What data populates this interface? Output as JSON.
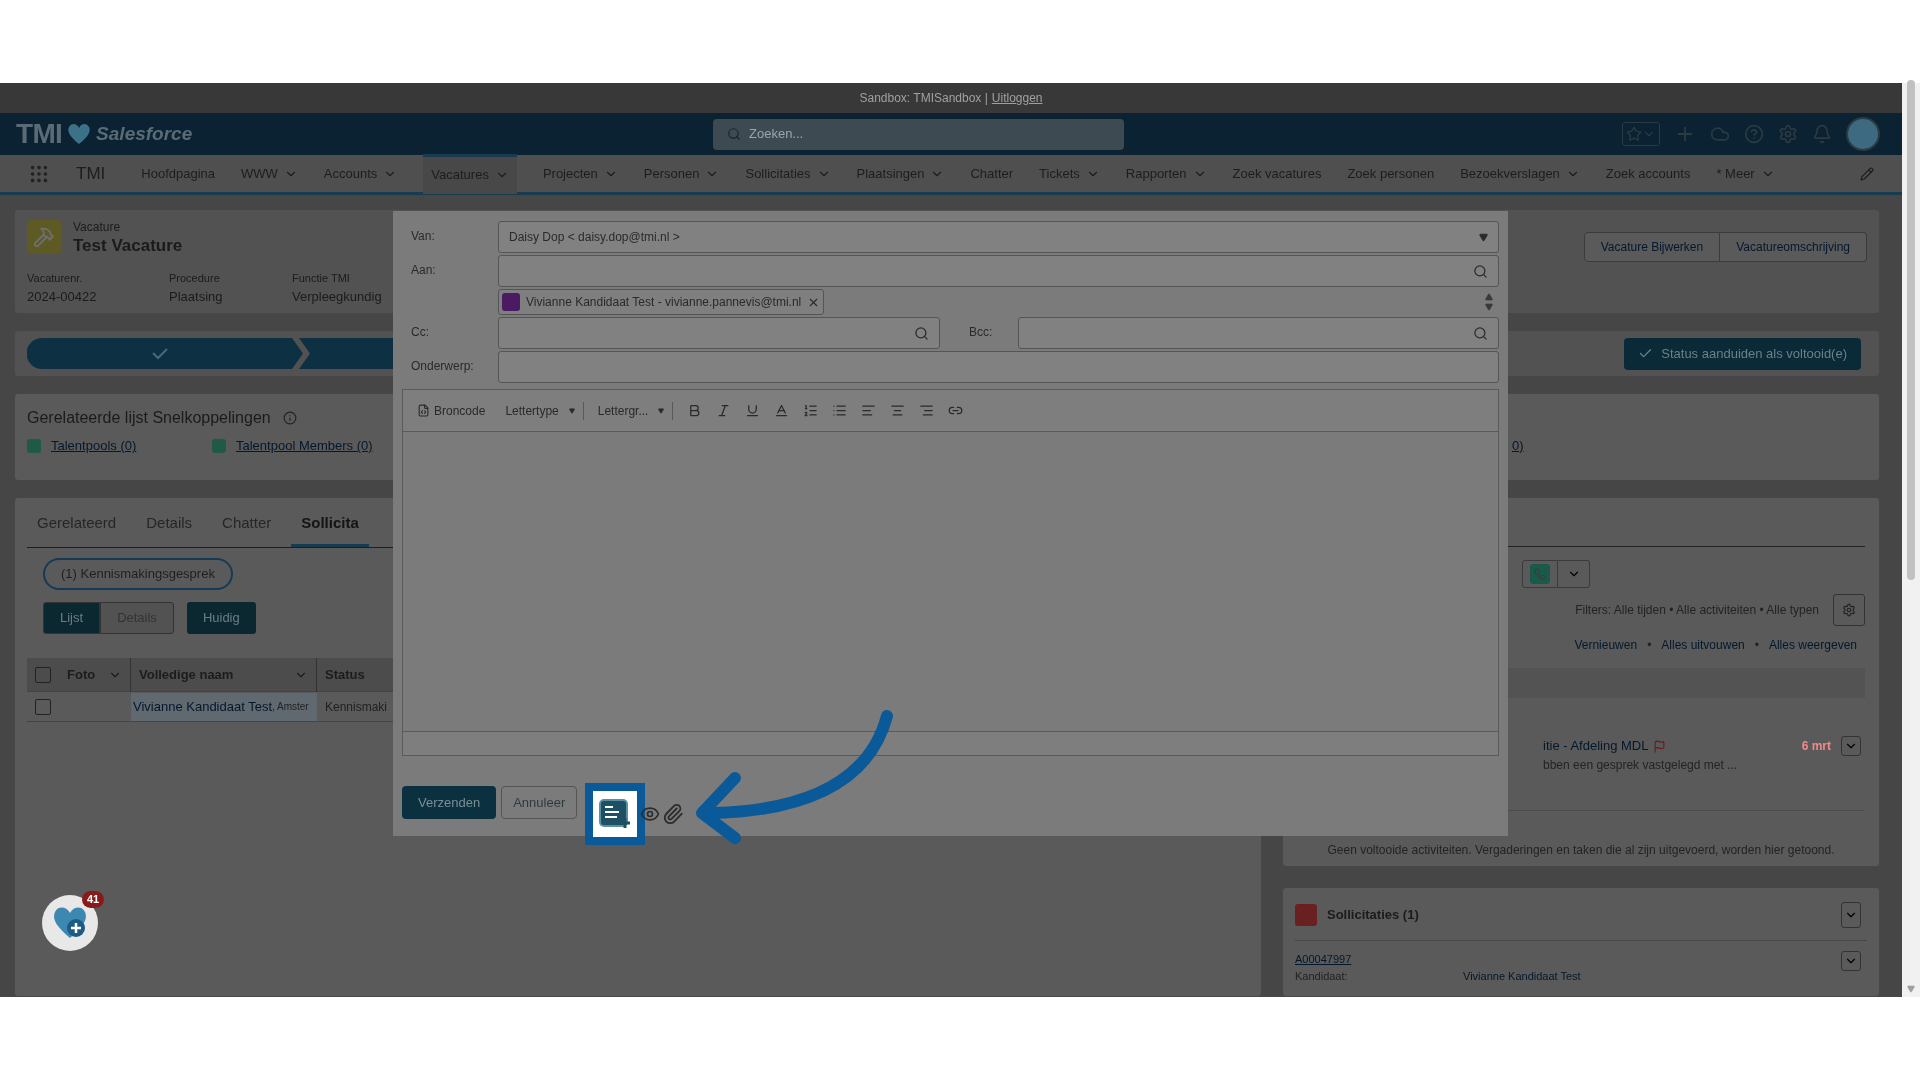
{
  "sandbox_bar": {
    "text": "Sandbox: TMISandbox |",
    "link": "Uitloggen"
  },
  "header": {
    "logo": "TMI",
    "brand": "Salesforce",
    "search": {
      "placeholder": "Zoeken..."
    }
  },
  "nav": {
    "app_name": "TMI",
    "items": [
      {
        "label": "Hoofdpagina",
        "dropdown": false,
        "selected": false
      },
      {
        "label": "WWW",
        "dropdown": true,
        "selected": false
      },
      {
        "label": "Accounts",
        "dropdown": true,
        "selected": false
      },
      {
        "label": "Vacatures",
        "dropdown": true,
        "selected": true
      },
      {
        "label": "Projecten",
        "dropdown": true,
        "selected": false
      },
      {
        "label": "Personen",
        "dropdown": true,
        "selected": false
      },
      {
        "label": "Sollicitaties",
        "dropdown": true,
        "selected": false
      },
      {
        "label": "Plaatsingen",
        "dropdown": true,
        "selected": false
      },
      {
        "label": "Chatter",
        "dropdown": false,
        "selected": false
      },
      {
        "label": "Tickets",
        "dropdown": true,
        "selected": false
      },
      {
        "label": "Rapporten",
        "dropdown": true,
        "selected": false
      },
      {
        "label": "Zoek vacatures",
        "dropdown": false,
        "selected": false
      },
      {
        "label": "Zoek personen",
        "dropdown": false,
        "selected": false
      },
      {
        "label": "Bezoekverslagen",
        "dropdown": true,
        "selected": false
      },
      {
        "label": "Zoek accounts",
        "dropdown": false,
        "selected": false
      }
    ],
    "more": "* Meer"
  },
  "record": {
    "type": "Vacature",
    "title": "Test Vacature",
    "fields": [
      {
        "label": "Vacaturenr.",
        "value": "2024-00422"
      },
      {
        "label": "Procedure",
        "value": "Plaatsing"
      },
      {
        "label": "Functie TMI",
        "value": "Verpleegkundig"
      }
    ],
    "actions": [
      "Vacature Bijwerken",
      "Vacatureomschrijving"
    ]
  },
  "path": {
    "complete_button": "Status aanduiden als voltooid(e)"
  },
  "quick_links": {
    "title": "Gerelateerde lijst Snelkoppelingen",
    "links": [
      "Talentpools (0)",
      "Talentpool Members (0)",
      "0)"
    ]
  },
  "tabs": [
    {
      "label": "Gerelateerd",
      "selected": false
    },
    {
      "label": "Details",
      "selected": false
    },
    {
      "label": "Chatter",
      "selected": false
    },
    {
      "label": "Sollicita",
      "selected": true
    }
  ],
  "list_view": {
    "filter_chip": "(1) Kennismakingsgesprek",
    "view_toggle": [
      {
        "label": "Lijst",
        "selected": true
      },
      {
        "label": "Details",
        "selected": false
      }
    ],
    "current_button": "Huidig",
    "all_selected": false,
    "columns": [
      {
        "label": "Foto",
        "kind": "sortable"
      },
      {
        "label": "Volledige naam",
        "kind": "sortable"
      },
      {
        "label": "Status",
        "kind": "plain"
      }
    ],
    "rows": [
      {
        "checked": false,
        "name": "Vivianne Kandidaat Test",
        "location": ", Amster",
        "status": "Kennismaki"
      }
    ]
  },
  "activity": {
    "filters": "Filters: Alle tijden • Alle activiteiten • Alle typen",
    "actions": [
      "Vernieuwen",
      "Alles uitvouwen",
      "Alles weergeven"
    ],
    "separator": "•",
    "item": {
      "title": "itie - Afdeling MDL",
      "date": "6 mrt",
      "description": "bben een gesprek vastgelegd met ..."
    },
    "empty_text": "Geen voltooide activiteiten. Vergaderingen en taken die al zijn uitgevoerd, worden hier getoond."
  },
  "applications_card": {
    "title": "Sollicitaties (1)",
    "record": "A00047997",
    "label": "Kandidaat:",
    "candidate": "Vivianne Kandidaat Test"
  },
  "email_dialog": {
    "from": {
      "label": "Van:",
      "value": "Daisy Dop < daisy.dop@tmi.nl >"
    },
    "to": {
      "label": "Aan:",
      "recipients": [
        "Vivianne Kandidaat Test - vivianne.pannevis@tmi.nl"
      ]
    },
    "cc": {
      "label": "Cc:"
    },
    "bcc": {
      "label": "Bcc:"
    },
    "subject": {
      "label": "Onderwerp:"
    },
    "toolbar": {
      "source": "Broncode",
      "font": "Lettertype",
      "size": "Lettergr..."
    },
    "send": "Verzenden",
    "cancel": "Annuleer"
  },
  "fab_badge": "41"
}
